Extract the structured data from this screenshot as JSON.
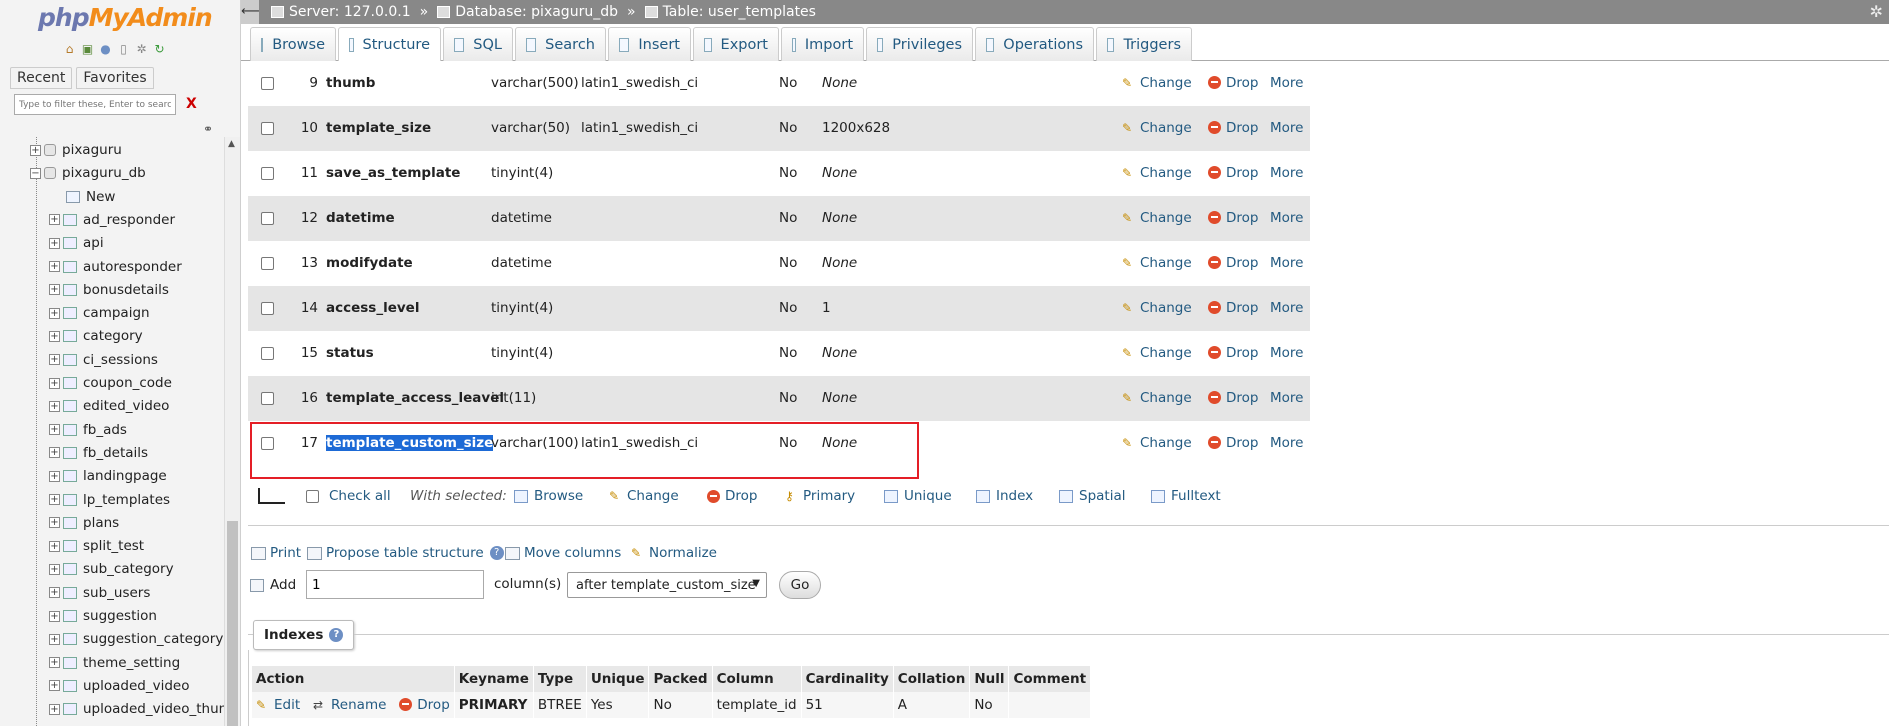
{
  "logo": {
    "php": "php",
    "myadmin": "MyAdmin"
  },
  "nav": {
    "tabs": [
      "Recent",
      "Favorites"
    ],
    "filter_placeholder": "Type to filter these, Enter to search all",
    "filter_clear": "X",
    "tree": {
      "dbs": [
        "pixaguru",
        "pixaguru_db"
      ],
      "new_label": "New",
      "tables": [
        "ad_responder",
        "api",
        "autoresponder",
        "bonusdetails",
        "campaign",
        "category",
        "ci_sessions",
        "coupon_code",
        "edited_video",
        "fb_ads",
        "fb_details",
        "landingpage",
        "lp_templates",
        "plans",
        "split_test",
        "sub_category",
        "sub_users",
        "suggestion",
        "suggestion_category",
        "theme_setting",
        "uploaded_video",
        "uploaded_video_thumb"
      ]
    }
  },
  "breadcrumb": {
    "server": "Server: 127.0.0.1",
    "database": "Database: pixaguru_db",
    "table": "Table: user_templates",
    "separator": "»"
  },
  "menu_tabs": [
    "Browse",
    "Structure",
    "SQL",
    "Search",
    "Insert",
    "Export",
    "Import",
    "Privileges",
    "Operations",
    "Triggers"
  ],
  "active_tab": "Structure",
  "columns": [
    {
      "num": "9",
      "name": "thumb",
      "type": "varchar(500)",
      "collation": "latin1_swedish_ci",
      "null": "No",
      "default": "None"
    },
    {
      "num": "10",
      "name": "template_size",
      "type": "varchar(50)",
      "collation": "latin1_swedish_ci",
      "null": "No",
      "default": "1200x628"
    },
    {
      "num": "11",
      "name": "save_as_template",
      "type": "tinyint(4)",
      "collation": "",
      "null": "No",
      "default": "None"
    },
    {
      "num": "12",
      "name": "datetime",
      "type": "datetime",
      "collation": "",
      "null": "No",
      "default": "None"
    },
    {
      "num": "13",
      "name": "modifydate",
      "type": "datetime",
      "collation": "",
      "null": "No",
      "default": "None"
    },
    {
      "num": "14",
      "name": "access_level",
      "type": "tinyint(4)",
      "collation": "",
      "null": "No",
      "default": "1"
    },
    {
      "num": "15",
      "name": "status",
      "type": "tinyint(4)",
      "collation": "",
      "null": "No",
      "default": "None"
    },
    {
      "num": "16",
      "name": "template_access_leavel",
      "type": "int(11)",
      "collation": "",
      "null": "No",
      "default": "None"
    },
    {
      "num": "17",
      "name": "template_custom_size",
      "type": "varchar(100)",
      "collation": "latin1_swedish_ci",
      "null": "No",
      "default": "None"
    }
  ],
  "row_actions": {
    "change": "Change",
    "drop": "Drop",
    "more": "More"
  },
  "bulk": {
    "check_all": "Check all",
    "with_selected": "With selected:",
    "actions": [
      "Browse",
      "Change",
      "Drop",
      "Primary",
      "Unique",
      "Index",
      "Spatial",
      "Fulltext"
    ]
  },
  "links": {
    "print": "Print",
    "propose": "Propose table structure",
    "move_columns": "Move columns",
    "normalize": "Normalize"
  },
  "add_column": {
    "label": "Add",
    "value": "1",
    "columns_label": "column(s)",
    "position": "after template_custom_size",
    "go": "Go"
  },
  "indexes": {
    "title": "Indexes",
    "headers": [
      "Action",
      "Keyname",
      "Type",
      "Unique",
      "Packed",
      "Column",
      "Cardinality",
      "Collation",
      "Null",
      "Comment"
    ],
    "row": {
      "edit": "Edit",
      "rename": "Rename",
      "drop": "Drop",
      "keyname": "PRIMARY",
      "type": "BTREE",
      "unique": "Yes",
      "packed": "No",
      "column": "template_id",
      "cardinality": "51",
      "collation": "A",
      "null": "No",
      "comment": ""
    }
  },
  "colors": {
    "link": "#235a81",
    "highlight": "#1d6ad6",
    "redbox": "#e41e26",
    "topbar": "#888888",
    "row_alt": "#e5e5e5"
  }
}
